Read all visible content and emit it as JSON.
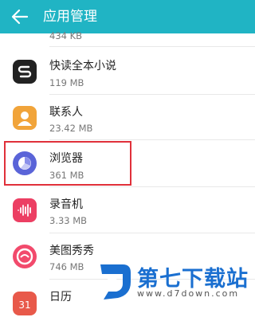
{
  "header": {
    "title": "应用管理",
    "back_icon": "arrow-left-icon",
    "background": "#20b4c4"
  },
  "apps": [
    {
      "name": "",
      "size": "434 KB"
    },
    {
      "name": "快读全本小说",
      "size": "119 MB",
      "icon": "kuaidu-app-icon"
    },
    {
      "name": "联系人",
      "size": "23.42 MB",
      "icon": "contacts-app-icon"
    },
    {
      "name": "浏览器",
      "size": "361 MB",
      "icon": "browser-app-icon",
      "highlighted": true
    },
    {
      "name": "录音机",
      "size": "3.33 MB",
      "icon": "recorder-app-icon"
    },
    {
      "name": "美图秀秀",
      "size": "746 MB",
      "icon": "meitu-app-icon"
    },
    {
      "name": "日历",
      "size": "",
      "icon": "calendar-app-icon",
      "icon_text": "31"
    }
  ],
  "watermark": {
    "title": "第七下载站",
    "url": "www.d7down.com"
  },
  "colors": {
    "highlight_border": "#e0303a",
    "watermark_blue": "#1a6fd0"
  }
}
